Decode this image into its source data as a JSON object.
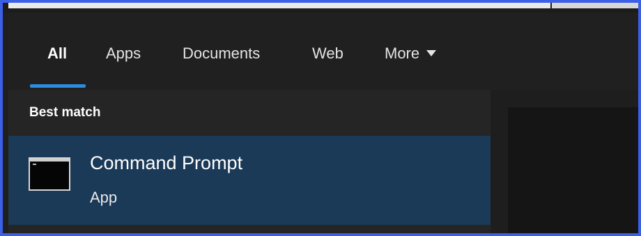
{
  "tabs": [
    {
      "label": "All",
      "active": true
    },
    {
      "label": "Apps",
      "active": false
    },
    {
      "label": "Documents",
      "active": false
    },
    {
      "label": "Web",
      "active": false
    },
    {
      "label": "More",
      "active": false,
      "has_dropdown": true
    }
  ],
  "section": {
    "label": "Best match"
  },
  "best_match": {
    "title": "Command Prompt",
    "subtitle": "App",
    "icon": "command-prompt-icon"
  },
  "colors": {
    "accent": "#2b8ce0",
    "selected_row": "#1a3a57",
    "frame_border": "#3b5fe6"
  }
}
